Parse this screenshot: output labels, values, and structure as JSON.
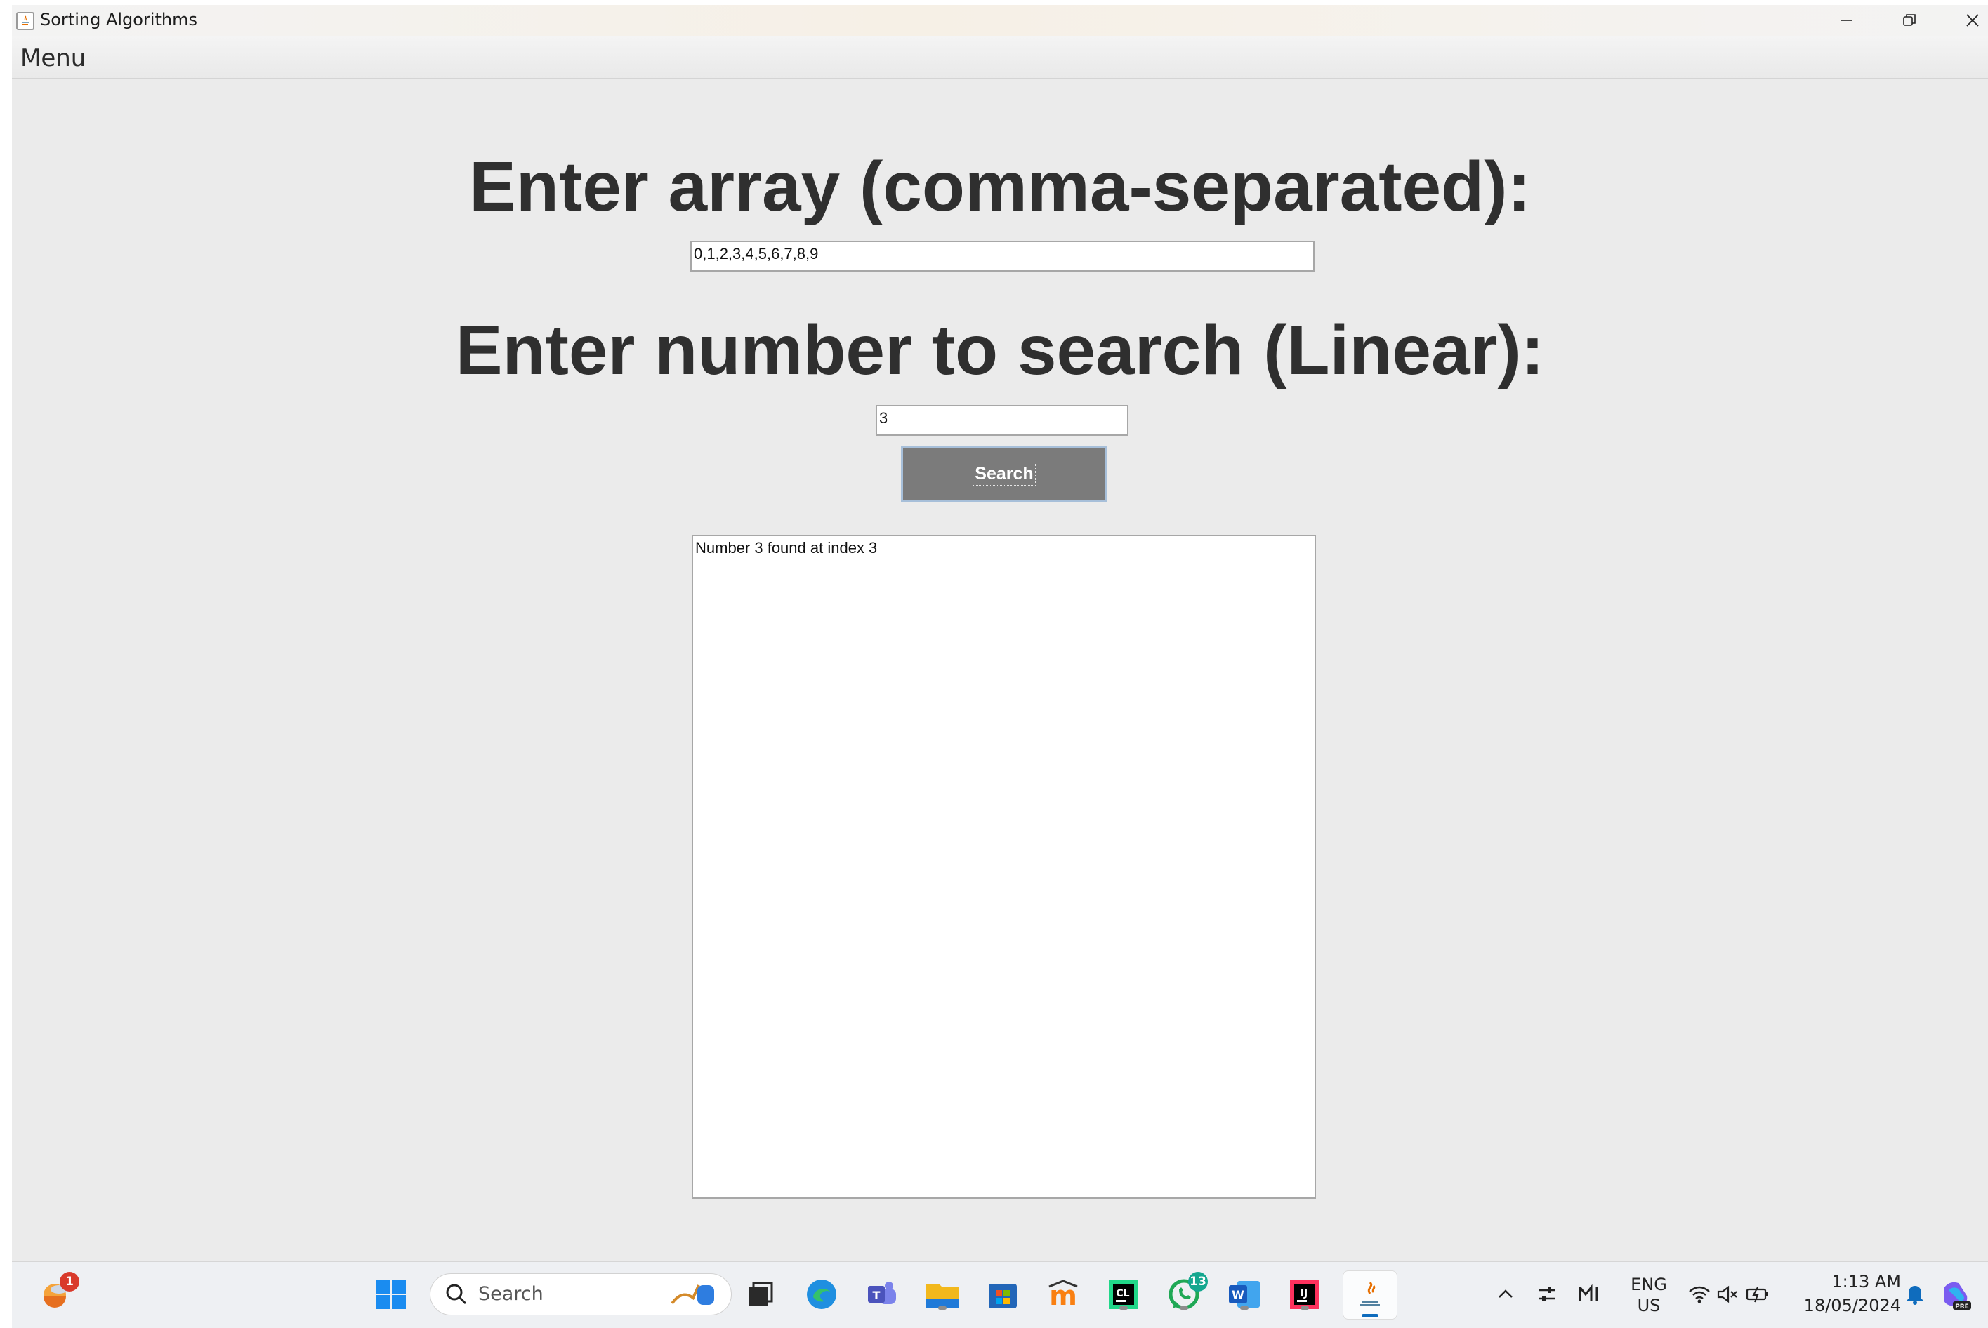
{
  "window": {
    "title": "Sorting Algorithms",
    "menu": [
      "Menu"
    ]
  },
  "form": {
    "array_label": "Enter array (comma-separated):",
    "array_value": "0,1,2,3,4,5,6,7,8,9",
    "search_label": "Enter number to search (Linear):",
    "search_value": "3",
    "search_button": "Search",
    "output_text": "Number 3 found at index 3"
  },
  "taskbar": {
    "search_placeholder": "Search",
    "weather_badge": "1",
    "whatsapp_badge": "13",
    "apps": [
      "windows-start",
      "task-view",
      "edge",
      "teams",
      "file-explorer",
      "microsoft-store",
      "moodle",
      "clion",
      "whatsapp",
      "word",
      "intellij-idea",
      "java"
    ],
    "tray": {
      "language_top": "ENG",
      "language_bottom": "US",
      "time": "1:13 AM",
      "date": "18/05/2024"
    }
  },
  "colors": {
    "window_bg": "#ebebeb",
    "button_bg": "#7b7b7b",
    "heading": "#2f2f2f",
    "accent": "#0f6cbd"
  }
}
